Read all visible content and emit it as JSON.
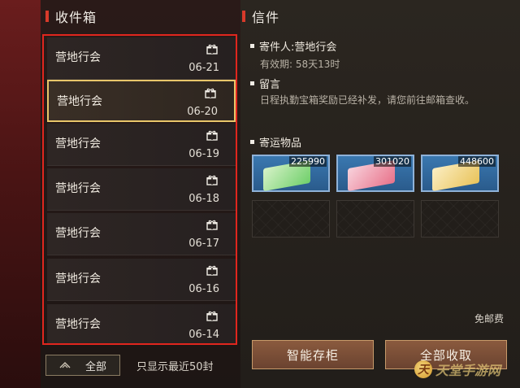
{
  "inbox": {
    "title": "收件箱",
    "items": [
      {
        "sender": "营地行会",
        "date": "06-21"
      },
      {
        "sender": "营地行会",
        "date": "06-20"
      },
      {
        "sender": "营地行会",
        "date": "06-19"
      },
      {
        "sender": "营地行会",
        "date": "06-18"
      },
      {
        "sender": "营地行会",
        "date": "06-17"
      },
      {
        "sender": "营地行会",
        "date": "06-16"
      },
      {
        "sender": "营地行会",
        "date": "06-14"
      }
    ],
    "selected_index": 1,
    "filter_label": "全部",
    "limit_note": "只显示最近50封"
  },
  "mail": {
    "title": "信件",
    "sender_label": "寄件人:营地行会",
    "validity": "有效期: 58天13时",
    "message_label": "留言",
    "message_text": "日程执勤宝箱奖励已经补发，请您前往邮箱查收。",
    "attachments_label": "寄运物品",
    "attachments": [
      {
        "count": "225990",
        "color": "#6fcf6a"
      },
      {
        "count": "301020",
        "color": "#e8728a"
      },
      {
        "count": "448600",
        "color": "#e9c35a"
      }
    ],
    "free_postage": "免邮费",
    "buttons": {
      "store": "智能存柜",
      "collect_all": "全部收取"
    }
  },
  "watermark": {
    "text": "天堂手游网",
    "logo_glyph": "天"
  },
  "colors": {
    "highlight_border": "#e0261e",
    "selected_border": "#e8c66a",
    "button_bg": "#7a4e36"
  }
}
